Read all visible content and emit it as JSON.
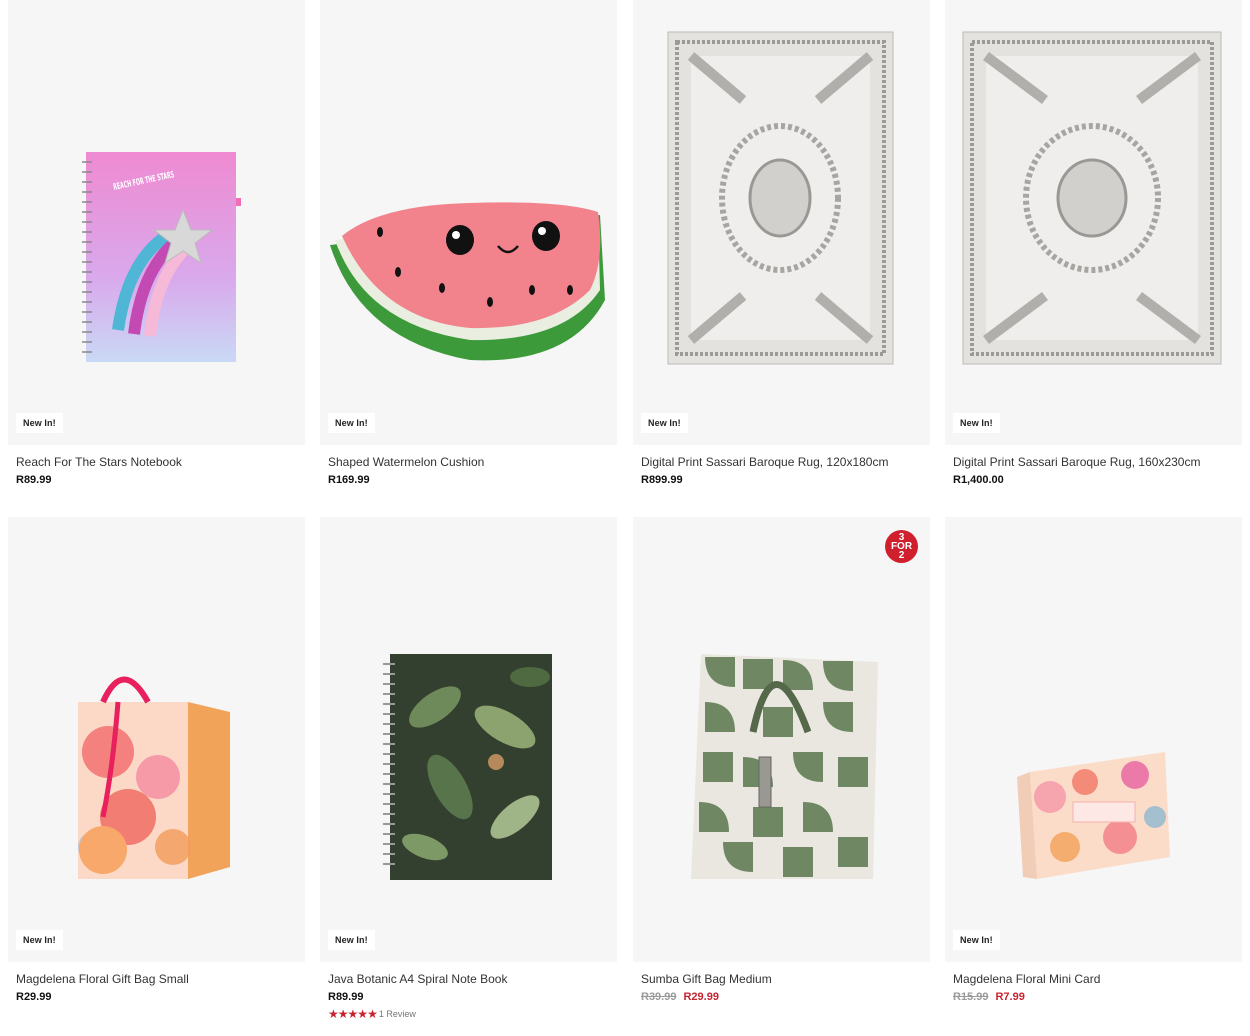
{
  "colors": {
    "sale": "#c8242f",
    "was": "#9a9a9a",
    "tile_bg": "#f6f6f6",
    "promo_bg": "#d0202e"
  },
  "products": [
    {
      "badge": "New In!",
      "title": "Reach For The Stars Notebook",
      "price": "R89.99",
      "image": "pink-notebook-image",
      "notebook_text": "REACH FOR THE STARS"
    },
    {
      "badge": "New In!",
      "title": "Shaped Watermelon Cushion",
      "price": "R169.99",
      "image": "watermelon-cushion-image"
    },
    {
      "badge": "New In!",
      "title": "Digital Print Sassari Baroque Rug, 120x180cm",
      "price": "R899.99",
      "image": "rug-image"
    },
    {
      "badge": "New In!",
      "title": "Digital Print Sassari Baroque Rug, 160x230cm",
      "price": "R1,400.00",
      "image": "rug-image"
    },
    {
      "badge": "New In!",
      "title": "Magdelena Floral Gift Bag Small",
      "price": "R29.99",
      "image": "floral-gift-bag-image"
    },
    {
      "badge": "New In!",
      "title": "Java Botanic A4 Spiral Note Book",
      "price": "R89.99",
      "image": "botanic-notebook-image",
      "rating": 5,
      "review_text": "1 Review"
    },
    {
      "promo": [
        "3",
        "FOR",
        "2"
      ],
      "title": "Sumba Gift Bag Medium",
      "was_price": "R39.99",
      "price": "R29.99",
      "image": "green-gift-bag-image"
    },
    {
      "badge": "New In!",
      "title": "Magdelena Floral Mini Card",
      "was_price": "R15.99",
      "price": "R7.99",
      "image": "floral-card-image"
    }
  ]
}
